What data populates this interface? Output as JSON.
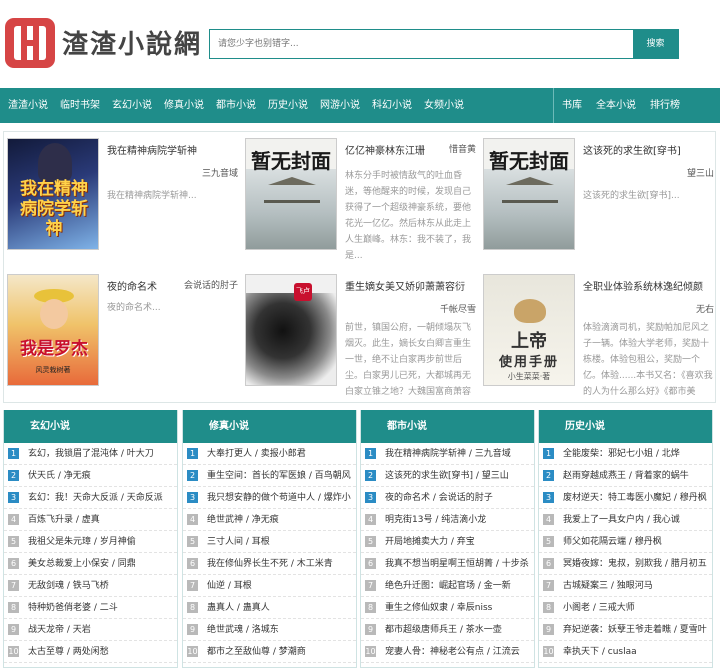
{
  "header": {
    "logo_text": "渣渣小說網",
    "search_placeholder": "请您少字也别错字...",
    "search_button": "搜索"
  },
  "nav": {
    "left": [
      "渣渣小说",
      "临时书架",
      "玄幻小说",
      "修真小说",
      "都市小说",
      "历史小说",
      "网游小说",
      "科幻小说",
      "女频小说"
    ],
    "right": [
      "书库",
      "全本小说",
      "排行榜"
    ]
  },
  "featured": [
    {
      "title": "我在精神病院学斩神",
      "author": "三九音域",
      "desc": "我在精神病院学斩神...",
      "cover_text": "我在精神病院学斩神"
    },
    {
      "title": "亿亿神豪林东江珊",
      "author": "惜音黄",
      "desc": "林东分手时被情敌气的吐血昏迷，等他醒来的时候，发现自己获得了一个超级神豪系统，要他花光一亿亿。然后林东从此走上人生巅峰。林东：我不装了，我是...",
      "cover_text": "暂无封面"
    },
    {
      "title": "这该死的求生欲[穿书]",
      "author": "望三山",
      "desc": "这该死的求生欲[穿书]...",
      "cover_text": "暂无封面"
    },
    {
      "title": "夜的命名术",
      "author": "会说话的肘子",
      "desc": "夜的命名术...",
      "cover_text": "我是罗杰",
      "cover_sub": "风灵栽树著"
    },
    {
      "title": "重生嫡女美又娇卯萧萧容衍",
      "author": "千帐尽雪",
      "desc": "前世，镇国公府，一朝倾塌灰飞烟灭。此生，嫡长女白卿言重生一世，绝不让白家再步前世后尘。白家男儿已死，大都城再无白家立锥之地？大魏国富商萧容衍...",
      "cover_text": "飞卢"
    },
    {
      "title": "全职业体验系统林逸纪倾颜",
      "author": "无右",
      "desc": "体验滴滴司机，奖励帕加尼风之子一辆。体验大学老师，奖励十栋楼。体验包租公，奖励一个亿。体验......本书又名：《喜欢我的人为什么那么好》《都市美人...",
      "cover_text": "上帝",
      "cover_sub": "使用手册",
      "cover_author": "小生菜菜·著"
    }
  ],
  "lists": [
    {
      "heading": "玄幻小说",
      "items": [
        "玄幻，我锁眉了混沌体 / 叶大刀",
        "伏天氏 / 净无痕",
        "玄幻：我！天命大反派 / 天命反派",
        "百炼飞升录 / 虚真",
        "我祖父是朱元璋 / 岁月神偷",
        "美女总裁爱上小保安 / 同鼎",
        "无敌剑魂 / 铁马飞桥",
        "特种奶爸俏老婆 / 二斗",
        "战天龙帝 / 天岩",
        "太古至尊 / 两处闲愁"
      ]
    },
    {
      "heading": "修真小说",
      "items": [
        "大奉打更人 / 卖报小郎君",
        "重生空间：首长的军医娘 / 百鸟朝风",
        "我只想安静的做个苟道中人 / 爆炸小",
        "绝世武神 / 净无痕",
        "三寸人间 / 耳根",
        "我在修仙界长生不死 / 木工米青",
        "仙逆 / 耳根",
        "蛊真人 / 蛊真人",
        "绝世武魂 / 洛城东",
        "都市之至敌仙尊 / 梦潮商"
      ]
    },
    {
      "heading": "都市小说",
      "items": [
        "我在精神病院学斩神 / 三九音域",
        "这该死的求生欲[穿书] / 望三山",
        "夜的命名术 / 会说话的肘子",
        "明克街13号 / 纯洁滴小龙",
        "开局地摊卖大力 / 弃宝",
        "我真不想当明星啊王恒胡菁 / 十步杀",
        "绝色升迁图：崛起官场 / 金一新",
        "重生之修仙奴隶 / 幸辰niss",
        "都市超级唐师兵王 / 茶水一壶",
        "宠妻人骨：神秘老公有点 / 江流云"
      ]
    },
    {
      "heading": "历史小说",
      "items": [
        "全能废柴：邪妃七小姐 / 北烨",
        "赵雨穿越成燕王 / 背着家的蜗牛",
        "废材逆天：特工毒医小魔妃 / 穆丹枫",
        "我爱上了一具女户内 / 我心诚",
        "师父如花隔云端 / 穆丹枫",
        "冥婚夜嫁：鬼叔，别欺我 / 腊月初五",
        "古城疑案三 / 独眼河马",
        "小阁老 / 三戒大师",
        "弃妃逆袭：妖孽王爷走着瞧 / 夏雪叶",
        "幸执天下 / cuslaa"
      ]
    }
  ],
  "colors": {
    "accent": "#1f8d8a",
    "rank_top": "#2b8cc4",
    "rank_other": "#b9b9b9",
    "logo_red": "#d64545"
  }
}
